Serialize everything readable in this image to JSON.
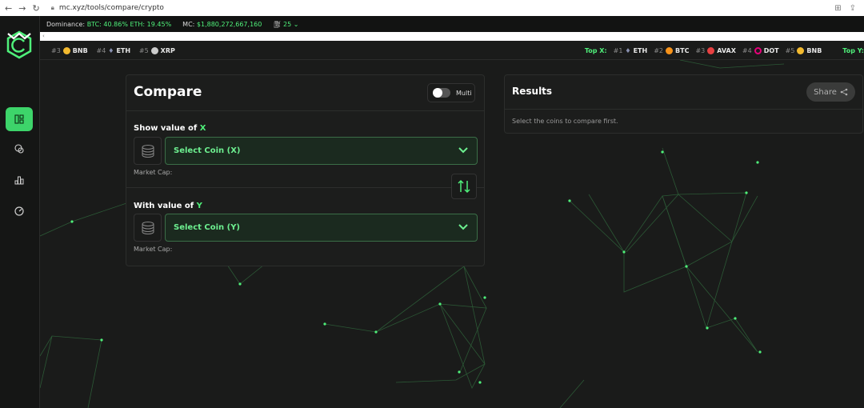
{
  "browser": {
    "url": "mc.xyz/tools/compare/crypto"
  },
  "statbar": {
    "dominance_label": "Dominance:",
    "dominance_value": "BTC: 40.86% ETH: 19.45%",
    "mc_label": "MC:",
    "mc_value": "$1,880,272,667,160",
    "gas": "25"
  },
  "ticker": {
    "left_items": [
      {
        "rank": "#3",
        "symbol": "BNB",
        "color": "#f3ba2f"
      },
      {
        "rank": "#4",
        "symbol": "ETH",
        "color": "#8a92b2"
      },
      {
        "rank": "#5",
        "symbol": "XRP",
        "color": "#cccccc"
      }
    ],
    "top_x_label": "Top X:",
    "top_x_items": [
      {
        "rank": "#1",
        "symbol": "ETH",
        "color": "#8a92b2"
      },
      {
        "rank": "#2",
        "symbol": "BTC",
        "color": "#f7931a"
      },
      {
        "rank": "#3",
        "symbol": "AVAX",
        "color": "#e84142"
      },
      {
        "rank": "#4",
        "symbol": "DOT",
        "color": "#e6007a"
      },
      {
        "rank": "#5",
        "symbol": "BNB",
        "color": "#f3ba2f"
      }
    ],
    "top_y_label": "Top Y:"
  },
  "sidebar": {
    "items": [
      {
        "name": "compare-icon",
        "active": true
      },
      {
        "name": "coins-icon",
        "active": false
      },
      {
        "name": "chart-icon",
        "active": false
      },
      {
        "name": "gauge-icon",
        "active": false
      }
    ]
  },
  "compare": {
    "title": "Compare",
    "multi_label": "Multi",
    "x_label_prefix": "Show value of ",
    "x_label_var": "X",
    "x_select": "Select Coin (X)",
    "x_sub": "Market Cap:",
    "y_label_prefix": "With value of ",
    "y_label_var": "Y",
    "y_select": "Select Coin (Y)",
    "y_sub": "Market Cap:"
  },
  "results": {
    "title": "Results",
    "share_label": "Share",
    "hint": "Select the coins to compare first."
  },
  "colors": {
    "accent": "#3dd46a",
    "background": "#1a1b1a"
  }
}
